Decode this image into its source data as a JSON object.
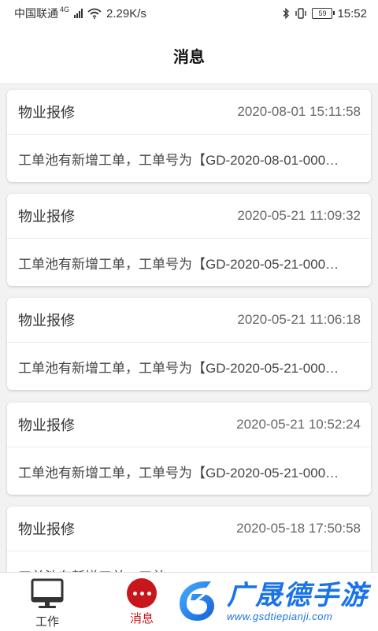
{
  "status_bar": {
    "carrier": "中国联通",
    "network": "4G",
    "speed": "2.29K/s",
    "battery": "59",
    "time": "15:52"
  },
  "header": {
    "title": "消息"
  },
  "messages": [
    {
      "type": "物业报修",
      "time": "2020-08-01 15:11:58",
      "body": "工单池有新增工单，工单号为【GD-2020-08-01-000…"
    },
    {
      "type": "物业报修",
      "time": "2020-05-21 11:09:32",
      "body": "工单池有新增工单，工单号为【GD-2020-05-21-000…"
    },
    {
      "type": "物业报修",
      "time": "2020-05-21 11:06:18",
      "body": "工单池有新增工单，工单号为【GD-2020-05-21-000…"
    },
    {
      "type": "物业报修",
      "time": "2020-05-21 10:52:24",
      "body": "工单池有新增工单，工单号为【GD-2020-05-21-000…"
    },
    {
      "type": "物业报修",
      "time": "2020-05-18 17:50:58",
      "body": "工单池有新增工单，工单…"
    }
  ],
  "tabbar": {
    "work_label": "工作",
    "messages_label": "消息",
    "active_color": "#c8161d"
  },
  "watermark": {
    "title": "广晟德手游",
    "url": "www.gsdtiepianji.com"
  },
  "icons": {
    "work": "monitor-icon",
    "messages": "chat-dots-icon",
    "bluetooth": "bluetooth-icon",
    "vibrate": "vibrate-icon",
    "wifi": "wifi-icon",
    "signal": "signal-icon",
    "battery": "battery-icon"
  }
}
